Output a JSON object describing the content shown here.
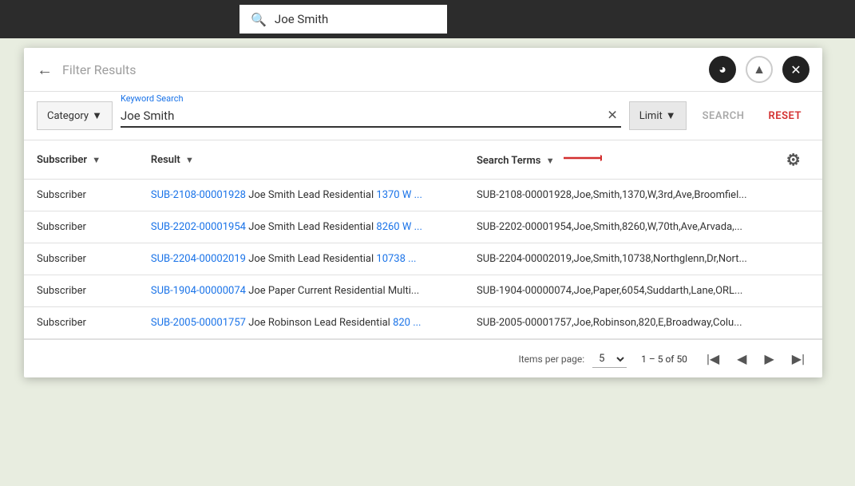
{
  "topBar": {
    "searchQuery": "Joe Smith"
  },
  "panel": {
    "filterTitle": "Filter Results",
    "backLabel": "←",
    "icons": {
      "compass": "◎",
      "collapse": "▲",
      "close": "✕"
    }
  },
  "searchRow": {
    "categoryLabel": "Category",
    "categoryArrow": "▼",
    "keywordLabel": "Keyword Search",
    "keywordValue": "Joe Smith",
    "clearLabel": "✕",
    "limitLabel": "Limit",
    "limitArrow": "▼",
    "searchLabel": "SEARCH",
    "resetLabel": "RESET"
  },
  "table": {
    "columns": {
      "subscriber": "Subscriber",
      "result": "Result",
      "searchTerms": "Search Terms",
      "sortIcon": "▼"
    },
    "rows": [
      {
        "subscriber": "Subscriber",
        "result": "SUB-2108-00001928 Joe Smith Lead Residential 1370 W ...",
        "searchTerms": "SUB-2108-00001928,Joe,Smith,1370,W,3rd,Ave,Broomfiel..."
      },
      {
        "subscriber": "Subscriber",
        "result": "SUB-2202-00001954 Joe Smith Lead Residential 8260 W ...",
        "searchTerms": "SUB-2202-00001954,Joe,Smith,8260,W,70th,Ave,Arvada,..."
      },
      {
        "subscriber": "Subscriber",
        "result": "SUB-2204-00002019 Joe Smith Lead Residential 10738 ...",
        "searchTerms": "SUB-2204-00002019,Joe,Smith,10738,Northglenn,Dr,Nort..."
      },
      {
        "subscriber": "Subscriber",
        "result": "SUB-1904-00000074 Joe Paper Current Residential Multi...",
        "searchTerms": "SUB-1904-00000074,Joe,Paper,6054,Suddarth,Lane,ORL..."
      },
      {
        "subscriber": "Subscriber",
        "result": "SUB-2005-00001757 Joe Robinson Lead Residential 820 ...",
        "searchTerms": "SUB-2005-00001757,Joe,Robinson,820,E,Broadway,Colu..."
      }
    ],
    "gearIcon": "⚙"
  },
  "pagination": {
    "itemsPerPageLabel": "Items per page:",
    "itemsPerPageValue": "5",
    "pageInfo": "1 – 5 of 50",
    "firstPage": "|◀",
    "prevPage": "◀",
    "nextPage": "▶",
    "lastPage": "▶|"
  }
}
